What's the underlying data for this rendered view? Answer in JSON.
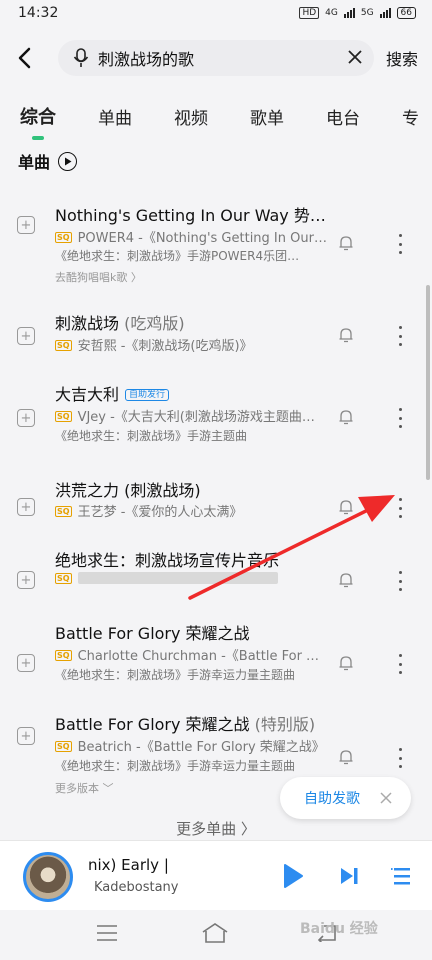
{
  "status_bar": {
    "time": "14:32",
    "hd": "HD",
    "net1": "4G",
    "net2": "5G",
    "battery": "66"
  },
  "search": {
    "query": "刺激战场的歌",
    "submit_label": "搜索"
  },
  "tabs": [
    "综合",
    "单曲",
    "视频",
    "歌单",
    "电台",
    "专"
  ],
  "section_title": "单曲",
  "songs": [
    {
      "title": "Nothing's Getting In Our Way 势…",
      "title_suffix": "",
      "tag": "",
      "quality": "SQ",
      "meta": "POWER4 -《Nothing's Getting In Our…",
      "meta2": "《绝地求生：刺激战场》手游POWER4乐团…",
      "extra": "去酷狗唱唱k歌 〉"
    },
    {
      "title": "刺激战场",
      "title_suffix": "(吃鸡版)",
      "tag": "",
      "quality": "SQ",
      "meta": "安哲熙 -《刺激战场(吃鸡版)》",
      "meta2": "",
      "extra": ""
    },
    {
      "title": "大吉大利",
      "title_suffix": "",
      "tag": "自助发行",
      "quality": "SQ",
      "meta": "VJey -《大吉大利(刺激战场游戏主题曲…",
      "meta2": "《绝地求生：刺激战场》手游主题曲",
      "extra": ""
    },
    {
      "title": "洪荒之力 (刺激战场)",
      "title_suffix": "",
      "tag": "",
      "quality": "SQ",
      "meta": "王艺梦 -《爱你的人心太满》",
      "meta2": "",
      "extra": ""
    },
    {
      "title": "绝地求生：刺激战场宣传片音乐",
      "title_suffix": "",
      "tag": "",
      "quality": "SQ",
      "meta": "",
      "meta2": "",
      "extra": ""
    },
    {
      "title": "Battle For Glory 荣耀之战",
      "title_suffix": "",
      "tag": "",
      "quality": "SQ",
      "meta": "Charlotte Churchman -《Battle For G…",
      "meta2": "《绝地求生：刺激战场》手游幸运力量主题曲",
      "extra": ""
    },
    {
      "title": "Battle For Glory 荣耀之战",
      "title_suffix": "(特别版)",
      "tag": "",
      "quality": "SQ",
      "meta": "Beatrich -《Battle For Glory 荣耀之战》",
      "meta2": "《绝地求生：刺激战场》手游幸运力量主题曲",
      "extra": "更多版本 ﹀"
    }
  ],
  "float_button": {
    "label": "自助发歌"
  },
  "more_songs": "更多单曲 〉",
  "player": {
    "title": "nix)      Early |",
    "artist": "Kadebostany"
  },
  "watermark": "Baidu 经验",
  "colors": {
    "accent_green": "#31c27c",
    "accent_blue": "#2d8cf0",
    "arrow_red": "#ee2a2a",
    "sq_gold": "#e6a100"
  }
}
